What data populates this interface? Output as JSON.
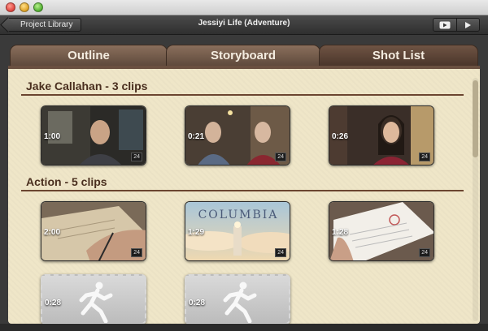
{
  "window": {
    "title": "Jessiyi Life (Adventure)"
  },
  "toolbar": {
    "back_label": "Project Library"
  },
  "tabs": [
    {
      "label": "Outline",
      "selected": false
    },
    {
      "label": "Storyboard",
      "selected": false
    },
    {
      "label": "Shot List",
      "selected": true
    }
  ],
  "sections": [
    {
      "title": "Jake Callahan - 3 clips",
      "clips": [
        {
          "duration": "1:00",
          "fps": "24"
        },
        {
          "duration": "0:21",
          "fps": "24"
        },
        {
          "duration": "0:26",
          "fps": "24"
        }
      ]
    },
    {
      "title": "Action - 5 clips",
      "clips": [
        {
          "duration": "2:00",
          "fps": "24"
        },
        {
          "duration": "1:29",
          "fps": "24",
          "overlay_text": "COLUMBIA"
        },
        {
          "duration": "1:28",
          "fps": "24"
        },
        {
          "duration": "0:28",
          "placeholder": true
        },
        {
          "duration": "0:28",
          "placeholder": true
        }
      ]
    }
  ],
  "colors": {
    "panel": "#efe6c8",
    "section_text": "#4a2f1f",
    "tab_selected": "#6f5444",
    "tab": "#8a6f5c"
  }
}
